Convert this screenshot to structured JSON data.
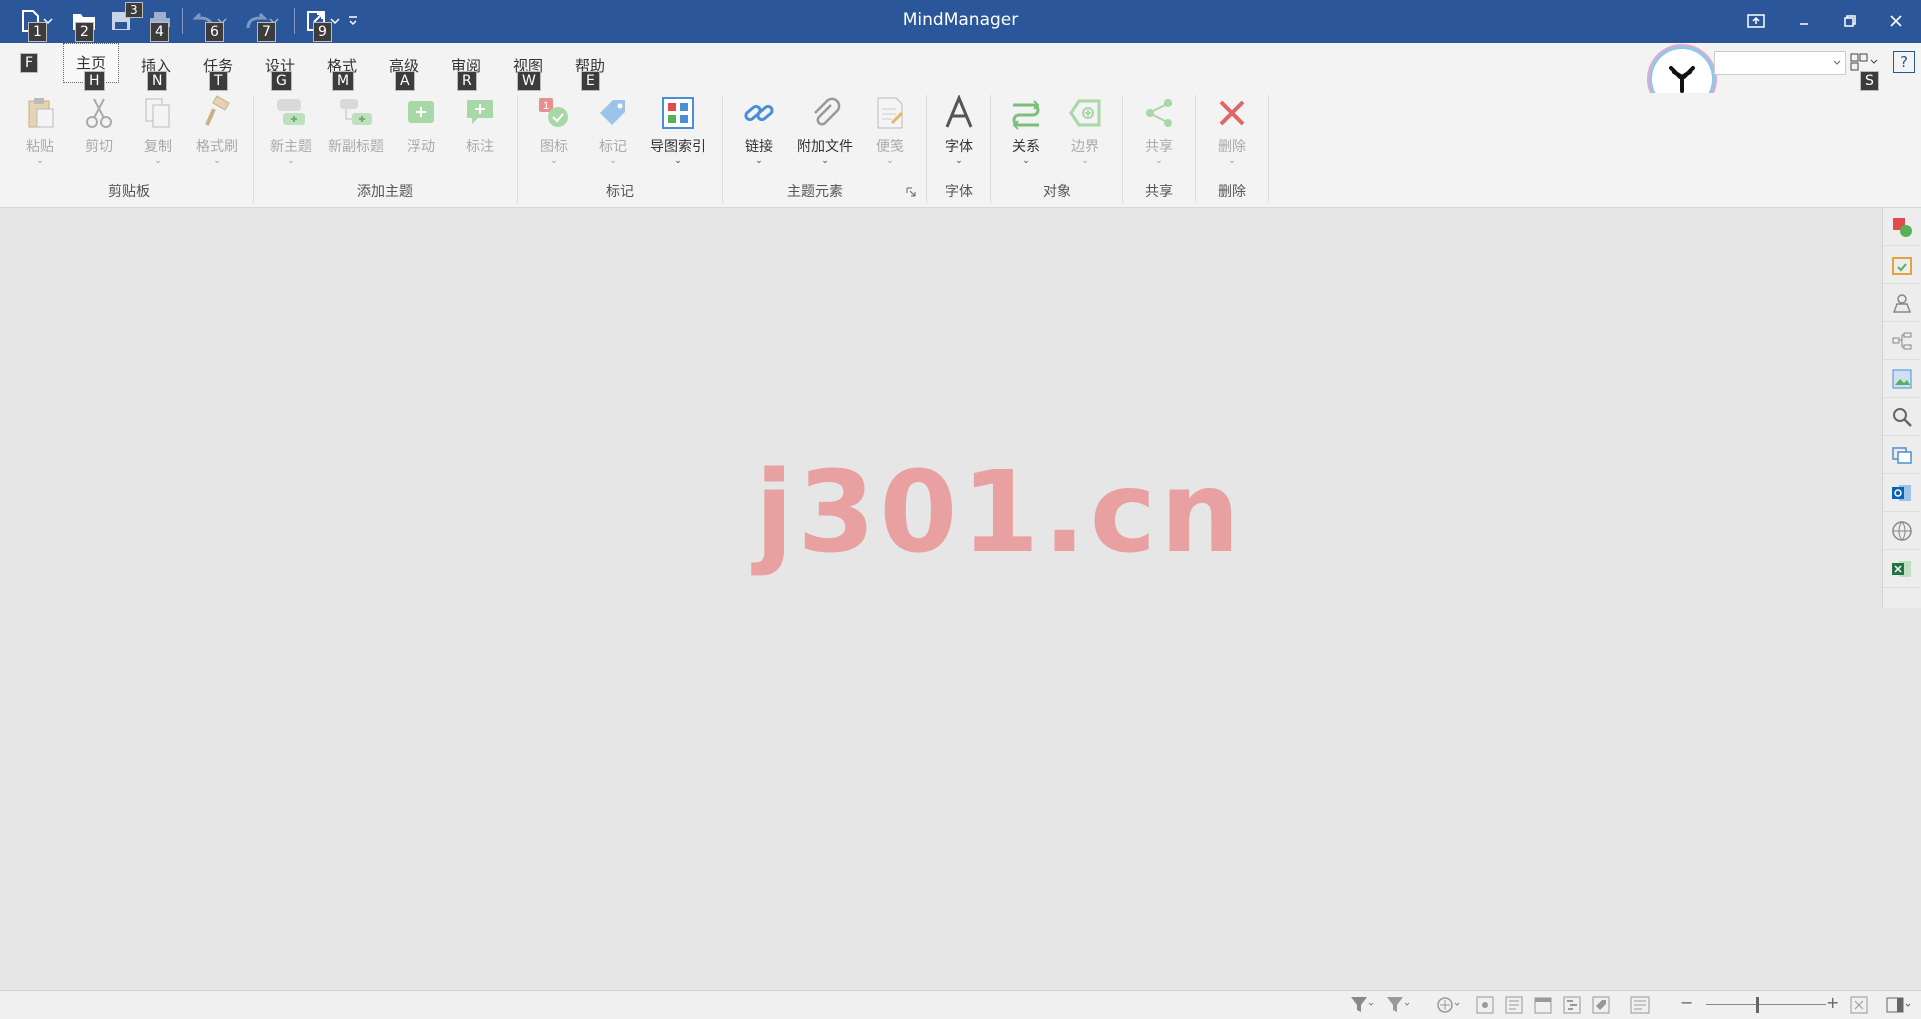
{
  "app": {
    "title": "MindManager"
  },
  "quick_access": {
    "keytips": [
      "1",
      "2",
      "3",
      "4",
      "6",
      "7",
      "9"
    ]
  },
  "menu": {
    "file_keytip": "F",
    "tabs": [
      {
        "label": "主页",
        "keytip": "H"
      },
      {
        "label": "插入",
        "keytip": "N"
      },
      {
        "label": "任务",
        "keytip": "T"
      },
      {
        "label": "设计",
        "keytip": "G"
      },
      {
        "label": "格式",
        "keytip": "M"
      },
      {
        "label": "高级",
        "keytip": "A"
      },
      {
        "label": "审阅",
        "keytip": "R"
      },
      {
        "label": "视图",
        "keytip": "W"
      },
      {
        "label": "帮助",
        "keytip": "E"
      }
    ],
    "search_keytip": "S",
    "help_label": "?"
  },
  "ribbon": {
    "buttons": [
      {
        "label": "粘贴"
      },
      {
        "label": "剪切"
      },
      {
        "label": "复制"
      },
      {
        "label": "格式刷"
      },
      {
        "label": "新主题"
      },
      {
        "label": "新副标题"
      },
      {
        "label": "浮动"
      },
      {
        "label": "标注"
      },
      {
        "label": "图标"
      },
      {
        "label": "标记"
      },
      {
        "label": "导图索引"
      },
      {
        "label": "链接"
      },
      {
        "label": "附加文件"
      },
      {
        "label": "便笺"
      },
      {
        "label": "字体"
      },
      {
        "label": "关系"
      },
      {
        "label": "边界"
      },
      {
        "label": "共享"
      },
      {
        "label": "删除"
      }
    ],
    "groups": [
      "剪贴板",
      "添加主题",
      "标记",
      "主题元素",
      "字体",
      "对象",
      "共享",
      "删除"
    ]
  },
  "canvas": {
    "watermark": "j301.cn"
  },
  "colors": {
    "title_bar": "#2b579a",
    "ribbon_bg": "#f3f3f3",
    "canvas_bg": "#e6e6e6",
    "watermark": "#e9a0a0"
  }
}
